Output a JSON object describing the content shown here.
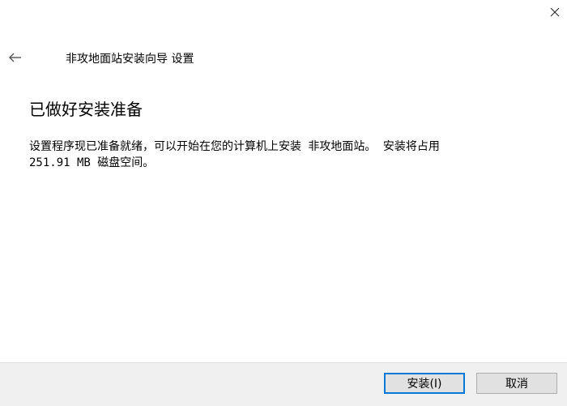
{
  "titlebar": {
    "close_icon": "close-icon"
  },
  "nav": {
    "back_icon": "back-arrow-icon",
    "wizard_title": "非攻地面站安装向导 设置"
  },
  "main": {
    "heading": "已做好安装准备",
    "description_line1": "设置程序现已准备就绪，可以开始在您的计算机上安装 非攻地面站。 安装将占用",
    "description_line2": "251.91 MB 磁盘空间。"
  },
  "footer": {
    "install_label": "安装(I)",
    "cancel_label": "取消"
  },
  "colors": {
    "footer_bg": "#f0f0f0",
    "button_bg": "#e1e1e1",
    "focus_border": "#0078d7"
  }
}
